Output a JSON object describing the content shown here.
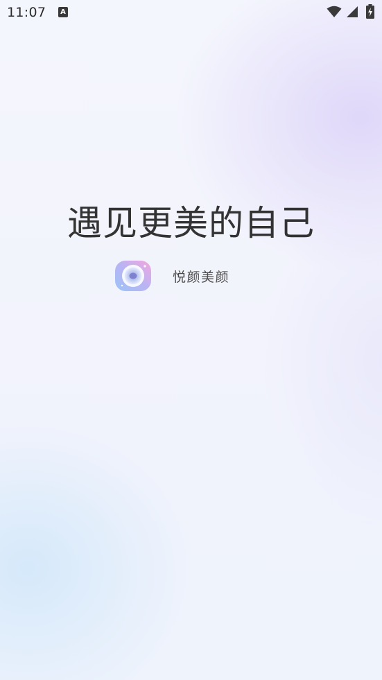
{
  "status_bar": {
    "time": "11:07",
    "notification_icon": "a-icon",
    "notification_letter": "A",
    "icons": [
      "wifi-icon",
      "signal-icon",
      "battery-charging-icon"
    ]
  },
  "splash": {
    "slogan": "遇见更美的自己",
    "brand_name": "悦颜美颜",
    "logo_icon": "camera-lens-logo-icon"
  },
  "colors": {
    "text_primary": "#333333",
    "text_secondary": "#4a4a4a",
    "logo_gradient_start": "#a8c8f8",
    "logo_gradient_end": "#f0a8e0"
  }
}
